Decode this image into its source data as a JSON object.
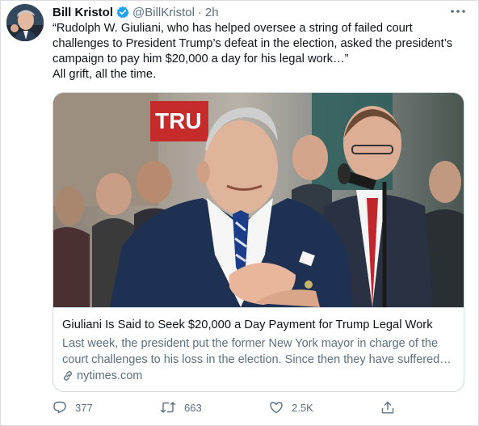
{
  "author": {
    "name": "Bill Kristol",
    "handle": "@BillKristol",
    "time": "2h",
    "verified": true
  },
  "tweet": {
    "lines": [
      "“Rudolph W. Giuliani, who has helped oversee a string of failed court",
      "challenges to President Trump’s defeat in the election, asked the president’s",
      "campaign to pay him $20,000 a day for his legal work…”",
      "All grift, all the time."
    ]
  },
  "card": {
    "title": "Giuliani Is Said to Seek $20,000 a Day Payment for Trump Legal Work",
    "description_lines": [
      "Last week, the president put the former New York mayor in charge of the",
      "court challenges to his loss in the election. Since then they have suffered…"
    ],
    "domain": "nytimes.com",
    "sign_text": "TRU"
  },
  "actions": {
    "reply_count": "377",
    "retweet_count": "663",
    "like_count": "2.5K"
  },
  "colors": {
    "text_primary": "#0f1419",
    "text_secondary": "#5b7083",
    "verified_blue": "#1da1f2",
    "card_border": "#cfd9de"
  },
  "icons": {
    "verified": "verified-badge-icon",
    "more": "more-dots-icon",
    "link": "link-icon",
    "reply": "reply-icon",
    "retweet": "retweet-icon",
    "like": "heart-icon",
    "share": "share-icon"
  }
}
